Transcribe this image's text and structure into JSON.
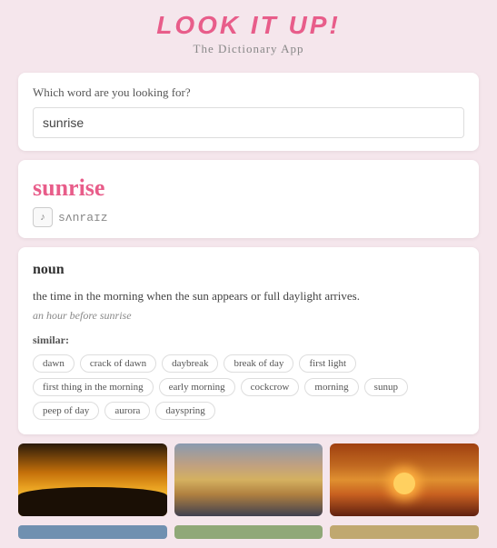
{
  "header": {
    "title": "LOOK IT UP!",
    "subtitle": "The Dictionary App"
  },
  "search": {
    "label": "Which word are you looking for?",
    "placeholder": "sunrise",
    "value": "sunrise"
  },
  "word": {
    "title": "sunrise",
    "pronunciation": "sʌnraɪz",
    "part_of_speech": "noun",
    "definition": "the time in the morning when the sun appears or full daylight arrives.",
    "example": "an hour before sunrise",
    "similar_label": "similar:",
    "similar_words": [
      "dawn",
      "crack of dawn",
      "daybreak",
      "break of day",
      "first light",
      "first thing in the morning",
      "early morning",
      "cockcrow",
      "morning",
      "sunup",
      "peep of day",
      "aurora",
      "dayspring"
    ]
  },
  "images": {
    "alt1": "sunrise silhouette",
    "alt2": "ocean sunrise",
    "alt3": "sunrise horizon"
  }
}
